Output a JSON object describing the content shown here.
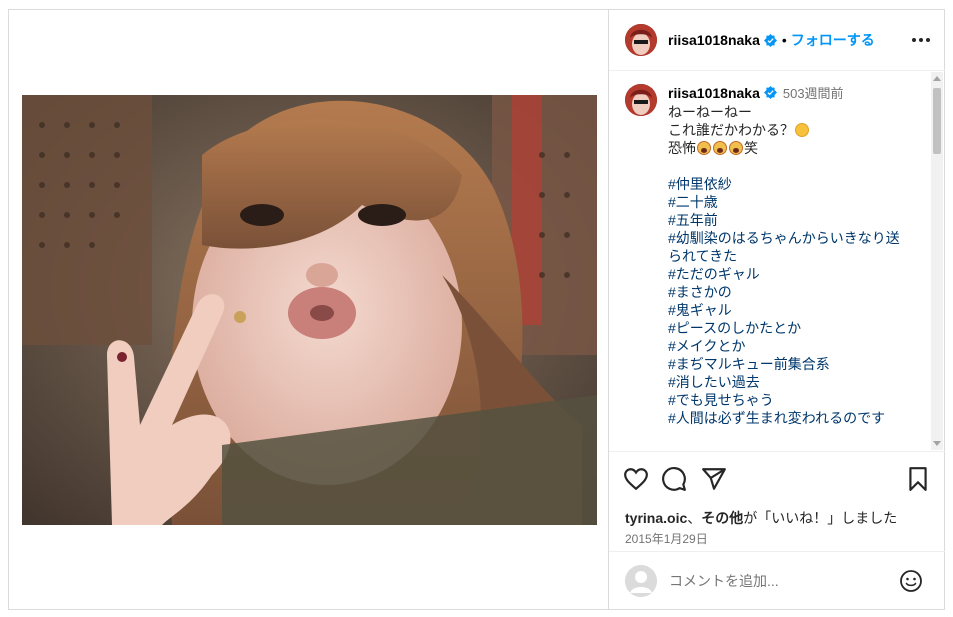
{
  "post": {
    "username": "riisa1018naka",
    "dot": "•",
    "follow_label": "フォローする",
    "photo_alt": ""
  },
  "caption": {
    "username": "riisa1018naka",
    "time": "503週間前",
    "lines": [
      "ねーねーねー",
      "これ誰だかわかる？",
      "恐怖",
      "笑"
    ],
    "hashtags": [
      "#仲里依紗",
      "#二十歳",
      "#五年前",
      "#幼馴染のはるちゃんからいきなり送",
      "られてきた",
      "#ただのギャル",
      "#まさかの",
      "#鬼ギャル",
      "#ピースのしかたとか",
      "#メイクとか",
      "#まぢマルキュー前集合系",
      "#消したい過去",
      "#でも見せちゃう",
      "#人間は必ず生まれ変われるのです"
    ]
  },
  "likes": {
    "user": "tyrina.oic",
    "sep": "、",
    "others": "その他",
    "suffix": "が「いいね！」しました"
  },
  "date": "2015年1月29日",
  "comment": {
    "placeholder": "コメントを追加..."
  },
  "icons": {
    "more": "more-horizontal-icon",
    "verified": "verified-badge-icon",
    "like": "heart-icon",
    "comment": "comment-icon",
    "share": "send-icon",
    "save": "bookmark-icon",
    "emoji": "emoji-icon"
  },
  "colors": {
    "accent": "#0095f6",
    "verified": "#0095f6",
    "hashtag": "#00376b",
    "muted": "#737373"
  }
}
